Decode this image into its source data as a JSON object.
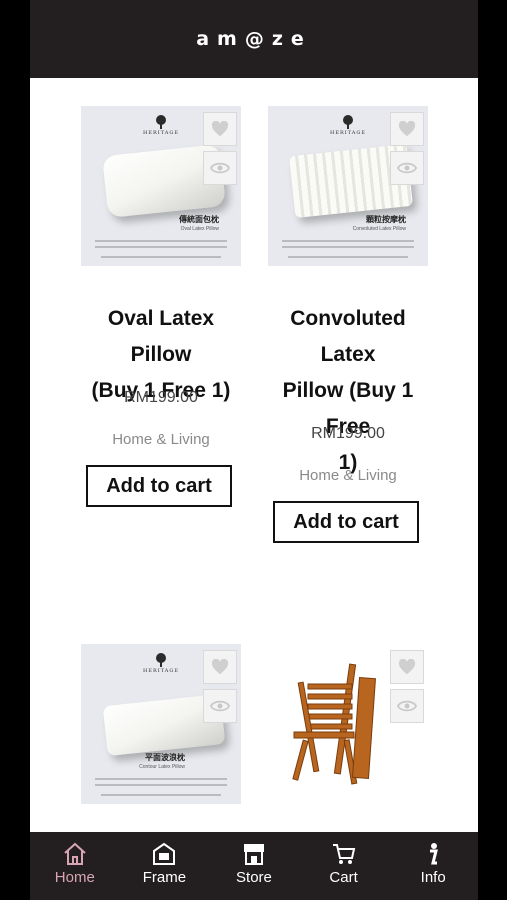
{
  "header": {
    "logo": "am@ze"
  },
  "products": [
    {
      "title_lines": [
        "Oval Latex Pillow",
        "(Buy 1 Free 1)"
      ],
      "price": "RM199.00",
      "category": "Home & Living",
      "cart_label": "Add to cart",
      "image": {
        "brand": "HERITAGE",
        "caption_cn": "傳統面包枕",
        "caption_en": "Oval Latex Pillow"
      }
    },
    {
      "title_lines": [
        "Convoluted Latex",
        "Pillow (Buy 1 Free",
        "1)"
      ],
      "price": "RM199.00",
      "category": "Home & Living",
      "cart_label": "Add to cart",
      "image": {
        "brand": "HERITAGE",
        "caption_cn": "顆粒按摩枕",
        "caption_en": "Convoluted Latex Pillow"
      }
    },
    {
      "image": {
        "brand": "HERITAGE",
        "caption_cn": "平面波浪枕",
        "caption_en": "Contour Latex Pillow"
      }
    },
    {
      "image": {
        "subject": "wooden folding chair"
      }
    }
  ],
  "nav": [
    {
      "label": "Home",
      "icon": "home-icon",
      "active": true
    },
    {
      "label": "Frame",
      "icon": "frame-icon"
    },
    {
      "label": "Store",
      "icon": "store-icon"
    },
    {
      "label": "Cart",
      "icon": "cart-icon"
    },
    {
      "label": "Info",
      "icon": "info-icon"
    }
  ],
  "colors": {
    "bar": "#231f20",
    "active_nav": "#d9a4b3",
    "image_bg": "#e7e9ee"
  }
}
